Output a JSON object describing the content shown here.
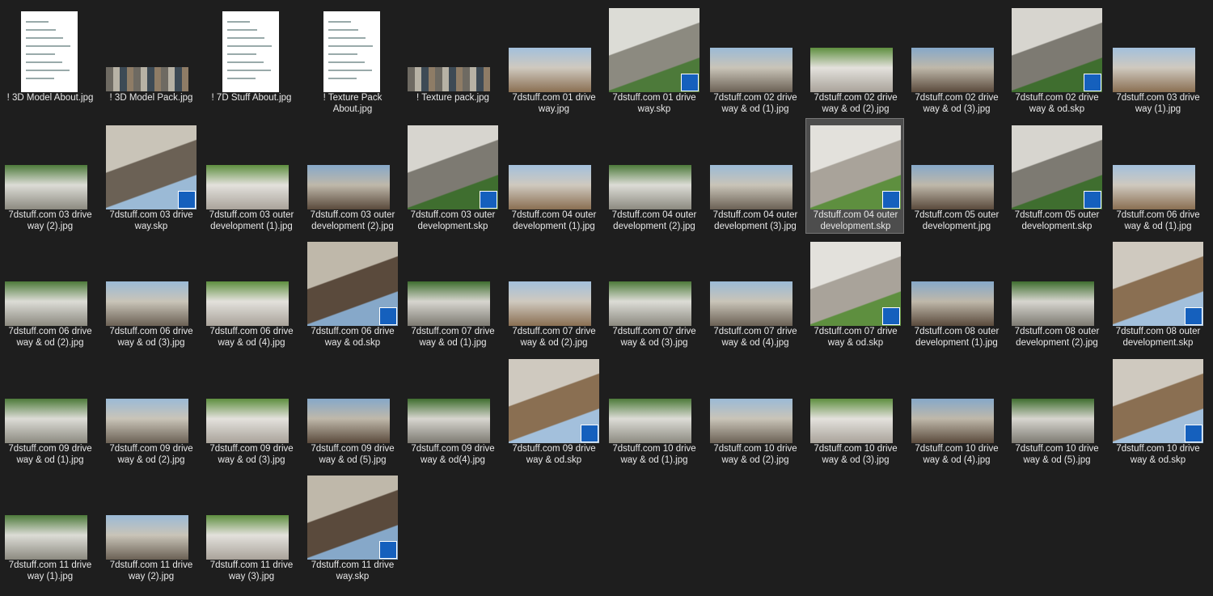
{
  "files": [
    {
      "name": "! 3D Model About.jpg",
      "kind": "doc"
    },
    {
      "name": "! 3D Model Pack.jpg",
      "kind": "strip"
    },
    {
      "name": "! 7D Stuff About.jpg",
      "kind": "doc"
    },
    {
      "name": "! Texture Pack About.jpg",
      "kind": "doc"
    },
    {
      "name": "! Texture pack.jpg",
      "kind": "strip"
    },
    {
      "name": "7dstuff.com 01 drive way.jpg",
      "kind": "jpg"
    },
    {
      "name": "7dstuff.com 01 drive way.skp",
      "kind": "skp"
    },
    {
      "name": "7dstuff.com 02 drive way & od (1).jpg",
      "kind": "jpg"
    },
    {
      "name": "7dstuff.com 02 drive way & od (2).jpg",
      "kind": "jpg"
    },
    {
      "name": "7dstuff.com 02 drive way & od (3).jpg",
      "kind": "jpg"
    },
    {
      "name": "7dstuff.com 02 drive way & od.skp",
      "kind": "skp"
    },
    {
      "name": "7dstuff.com 03 drive way (1).jpg",
      "kind": "jpg"
    },
    {
      "name": "7dstuff.com 03 drive way (2).jpg",
      "kind": "jpg"
    },
    {
      "name": "7dstuff.com 03 drive way.skp",
      "kind": "skp"
    },
    {
      "name": "7dstuff.com 03 outer development (1).jpg",
      "kind": "jpg"
    },
    {
      "name": "7dstuff.com 03 outer development (2).jpg",
      "kind": "jpg"
    },
    {
      "name": "7dstuff.com 03 outer development.skp",
      "kind": "skp"
    },
    {
      "name": "7dstuff.com 04 outer development (1).jpg",
      "kind": "jpg"
    },
    {
      "name": "7dstuff.com 04 outer development (2).jpg",
      "kind": "jpg"
    },
    {
      "name": "7dstuff.com 04 outer development (3).jpg",
      "kind": "jpg"
    },
    {
      "name": "7dstuff.com 04 outer development.skp",
      "kind": "skp",
      "selected": true
    },
    {
      "name": "7dstuff.com 05 outer development.jpg",
      "kind": "jpg"
    },
    {
      "name": "7dstuff.com 05 outer development.skp",
      "kind": "skp"
    },
    {
      "name": "7dstuff.com 06 drive way & od (1).jpg",
      "kind": "jpg"
    },
    {
      "name": "7dstuff.com 06 drive way & od (2).jpg",
      "kind": "jpg"
    },
    {
      "name": "7dstuff.com 06 drive way & od (3).jpg",
      "kind": "jpg"
    },
    {
      "name": "7dstuff.com 06 drive way & od (4).jpg",
      "kind": "jpg"
    },
    {
      "name": "7dstuff.com 06 drive way & od.skp",
      "kind": "skp"
    },
    {
      "name": "7dstuff.com 07 drive way & od (1).jpg",
      "kind": "jpg"
    },
    {
      "name": "7dstuff.com 07 drive way & od (2).jpg",
      "kind": "jpg"
    },
    {
      "name": "7dstuff.com 07 drive way & od (3).jpg",
      "kind": "jpg"
    },
    {
      "name": "7dstuff.com 07 drive way & od (4).jpg",
      "kind": "jpg"
    },
    {
      "name": "7dstuff.com 07 drive way & od.skp",
      "kind": "skp"
    },
    {
      "name": "7dstuff.com 08 outer development (1).jpg",
      "kind": "jpg"
    },
    {
      "name": "7dstuff.com 08 outer development (2).jpg",
      "kind": "jpg"
    },
    {
      "name": "7dstuff.com 08 outer development.skp",
      "kind": "skp"
    },
    {
      "name": "7dstuff.com 09 drive way & od (1).jpg",
      "kind": "jpg"
    },
    {
      "name": "7dstuff.com 09 drive way & od (2).jpg",
      "kind": "jpg"
    },
    {
      "name": "7dstuff.com 09 drive way & od (3).jpg",
      "kind": "jpg"
    },
    {
      "name": "7dstuff.com 09 drive way & od (5).jpg",
      "kind": "jpg"
    },
    {
      "name": "7dstuff.com 09 drive way & od(4).jpg",
      "kind": "jpg"
    },
    {
      "name": "7dstuff.com 09 drive way & od.skp",
      "kind": "skp"
    },
    {
      "name": "7dstuff.com 10 drive way & od (1).jpg",
      "kind": "jpg"
    },
    {
      "name": "7dstuff.com 10 drive way & od (2).jpg",
      "kind": "jpg"
    },
    {
      "name": "7dstuff.com 10 drive way & od (3).jpg",
      "kind": "jpg"
    },
    {
      "name": "7dstuff.com 10 drive way & od (4).jpg",
      "kind": "jpg"
    },
    {
      "name": "7dstuff.com 10 drive way & od (5).jpg",
      "kind": "jpg"
    },
    {
      "name": "7dstuff.com 10 drive way & od.skp",
      "kind": "skp"
    },
    {
      "name": "7dstuff.com 11 drive way (1).jpg",
      "kind": "jpg"
    },
    {
      "name": "7dstuff.com 11 drive way (2).jpg",
      "kind": "jpg"
    },
    {
      "name": "7dstuff.com 11 drive way (3).jpg",
      "kind": "jpg"
    },
    {
      "name": "7dstuff.com 11 drive way.skp",
      "kind": "skp"
    }
  ],
  "colors": {
    "background": "#1e1e1e",
    "label": "#e8e8e8",
    "selection": "#4d4d4d",
    "sketchup": "#1560bd"
  }
}
